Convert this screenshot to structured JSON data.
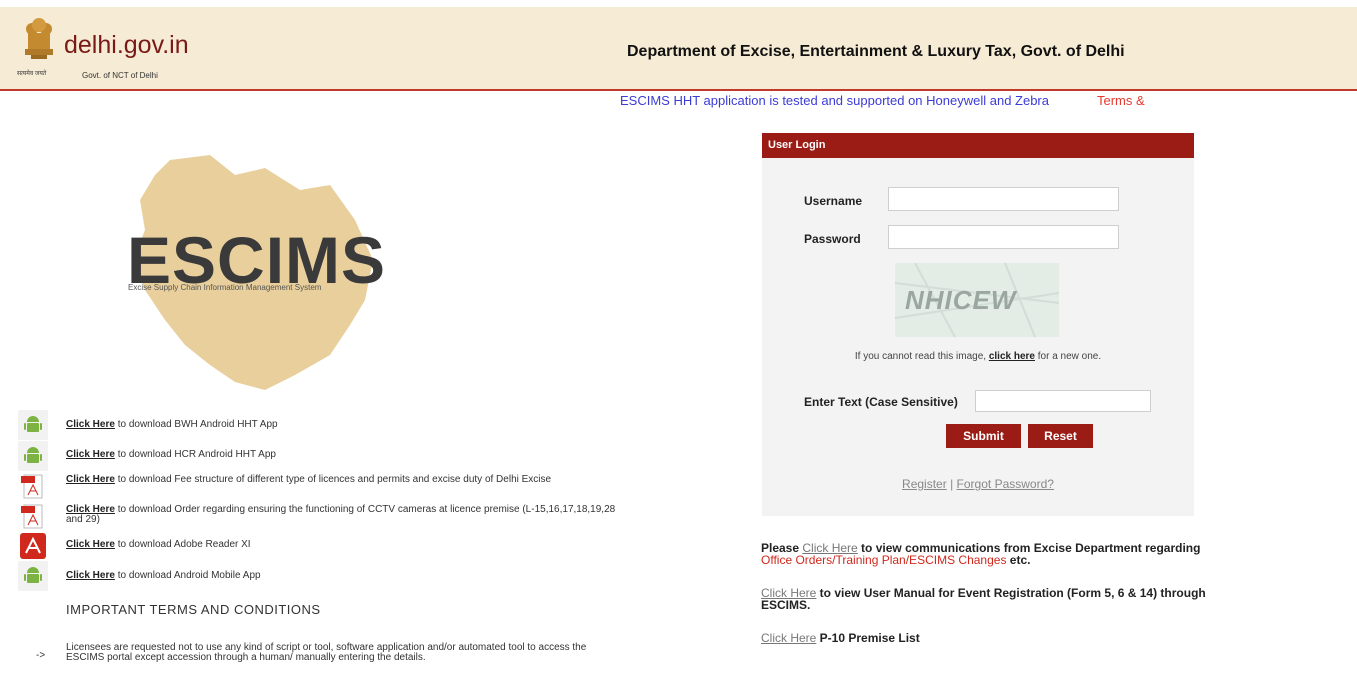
{
  "header": {
    "site_name": "delhi.gov.in",
    "emblem_text": "सत्यमेव जयते",
    "govt_sub": "Govt. of NCT of Delhi",
    "dept_title": "Department of Excise, Entertainment & Luxury Tax, Govt. of Delhi"
  },
  "ticker": {
    "message": "ESCIMS HHT application is tested and supported on Honeywell and Zebra",
    "terms": "Terms &"
  },
  "logo": {
    "title": "ESCIMS",
    "subtitle": "Excise Supply Chain Information Management System"
  },
  "downloads": [
    {
      "link": "Click Here",
      "text": " to download BWH Android HHT App",
      "icon": "android-icon"
    },
    {
      "link": "Click Here",
      "text": " to download HCR Android HHT App",
      "icon": "android-icon"
    },
    {
      "link": "Click Here",
      "text": " to download Fee structure of different type of licences and permits and excise duty of Delhi Excise",
      "icon": "pdf-icon"
    },
    {
      "link": "Click Here",
      "text": " to download Order regarding ensuring the functioning of CCTV cameras at licence premise (L-15,16,17,18,19,28 and 29)",
      "icon": "pdf-icon"
    },
    {
      "link": "Click Here",
      "text": " to download Adobe Reader XI",
      "icon": "adobe-reader-icon"
    },
    {
      "link": "Click Here",
      "text": " to download Android Mobile App",
      "icon": "android-icon"
    }
  ],
  "terms": {
    "title": "IMPORTANT TERMS AND CONDITIONS",
    "arrow": "->",
    "item1": "Licensees are requested not to use any kind of script or tool, software application and/or automated tool to access the ESCIMS portal except accession through a human/ manually entering the details."
  },
  "login": {
    "heading": "User Login",
    "username_label": "Username",
    "username_value": "",
    "password_label": "Password",
    "password_value": "",
    "captcha_text": "NHICEW",
    "hint_prefix": "If you cannot read this image, ",
    "hint_link": "click here",
    "hint_suffix": " for a new one.",
    "enter_text_label": "Enter Text (Case Sensitive)",
    "enter_text_value": "",
    "submit": "Submit",
    "reset": "Reset",
    "register": "Register",
    "separator": "|",
    "forgot": "Forgot Password?"
  },
  "notes": {
    "n1_prefix": "Please ",
    "n1_link": "Click Here",
    "n1_mid": " to view communications from Excise Department regarding ",
    "n1_red": "Office Orders/Training Plan/ESCIMS Changes",
    "n1_suffix": " etc.",
    "n2_link": "Click Here",
    "n2_text": " to view User Manual for Event Registration (Form 5, 6 & 14) through ESCIMS.",
    "n3_link": "Click Here",
    "n3_text": " P-10 Premise List"
  },
  "colors": {
    "header_bg": "#f6ebd4",
    "brand_red": "#9b1c14",
    "ticker_blue": "#3b3bd6",
    "ticker_red": "#e23a2f",
    "logo_map": "#e8cf9c",
    "android_green": "#7cb342"
  }
}
